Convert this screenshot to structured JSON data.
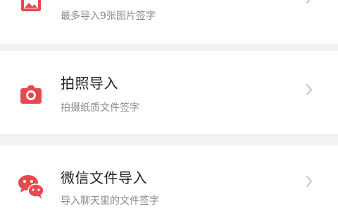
{
  "items": [
    {
      "title": "",
      "subtitle": "最多导入9张图片签字",
      "icon": "image-icon"
    },
    {
      "title": "拍照导入",
      "subtitle": "拍摄纸质文件签字",
      "icon": "camera-icon"
    },
    {
      "title": "微信文件导入",
      "subtitle": "导入聊天里的文件签字",
      "icon": "wechat-icon"
    }
  ],
  "colors": {
    "accent": "#e8484e",
    "background": "#f2f2f4",
    "card": "#ffffff",
    "title": "#222222",
    "subtitle": "#8a8a8a",
    "chevron": "#c4c4c4"
  }
}
